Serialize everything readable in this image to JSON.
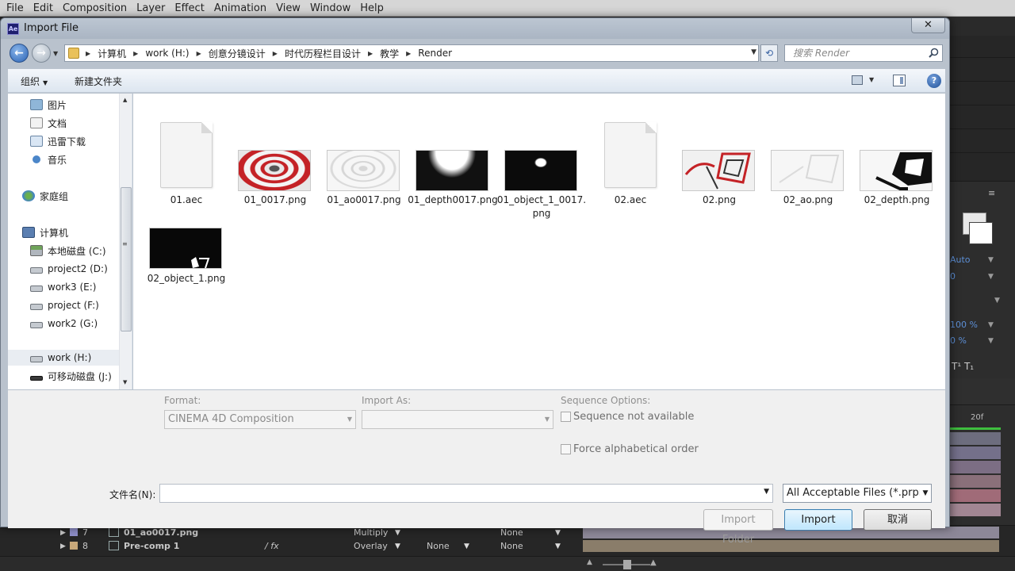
{
  "ae": {
    "menu": [
      "File",
      "Edit",
      "Composition",
      "Layer",
      "Effect",
      "Animation",
      "View",
      "Window",
      "Help"
    ],
    "right_panel": {
      "auto": "Auto",
      "zero": "0",
      "pct1": "100 %",
      "pct2": "0 %",
      "frame": "20f"
    },
    "timeline": [
      {
        "index": "7",
        "name": "01_ao0017.png",
        "mode": "Multiply",
        "trkmat": "",
        "parent": "None"
      },
      {
        "index": "8",
        "name": "Pre-comp 1",
        "mode": "Overlay",
        "trkmat": "None",
        "parent": "None"
      }
    ]
  },
  "dialog": {
    "title": "Import File",
    "close_label": "✕",
    "breadcrumbs": [
      "计算机",
      "work (H:)",
      "创意分镜设计",
      "时代历程栏目设计",
      "教学",
      "Render"
    ],
    "search_placeholder": "搜索 Render",
    "toolbar": {
      "organize": "组织",
      "new_folder": "新建文件夹"
    },
    "nav_items": [
      {
        "label": "图片",
        "icon": "pictures-icon"
      },
      {
        "label": "文档",
        "icon": "documents-icon"
      },
      {
        "label": "迅雷下载",
        "icon": "downloads-icon"
      },
      {
        "label": "音乐",
        "icon": "music-icon"
      },
      {
        "label": "家庭组",
        "icon": "homegroup-icon"
      },
      {
        "label": "计算机",
        "icon": "computer-icon"
      },
      {
        "label": "本地磁盘 (C:)",
        "icon": "drive-icon"
      },
      {
        "label": "project2 (D:)",
        "icon": "drive-icon"
      },
      {
        "label": "work3 (E:)",
        "icon": "drive-icon"
      },
      {
        "label": "project (F:)",
        "icon": "drive-icon"
      },
      {
        "label": "work2 (G:)",
        "icon": "drive-icon"
      },
      {
        "label": "work (H:)",
        "icon": "drive-icon"
      },
      {
        "label": "可移动磁盘 (J:)",
        "icon": "removable-drive-icon"
      }
    ],
    "selected_nav": "work (H:)",
    "files": [
      {
        "name": "01.aec",
        "kind": "doc"
      },
      {
        "name": "01_0017.png",
        "kind": "image"
      },
      {
        "name": "01_ao0017.png",
        "kind": "image"
      },
      {
        "name": "01_depth0017.png",
        "kind": "image"
      },
      {
        "name": "01_object_1_0017.png",
        "kind": "image"
      },
      {
        "name": "02.aec",
        "kind": "doc"
      },
      {
        "name": "02.png",
        "kind": "image"
      },
      {
        "name": "02_ao.png",
        "kind": "image"
      },
      {
        "name": "02_depth.png",
        "kind": "image"
      },
      {
        "name": "02_object_1.png",
        "kind": "image"
      }
    ],
    "options": {
      "format_label": "Format:",
      "format_value": "CINEMA 4D Composition",
      "import_as_label": "Import As:",
      "import_as_value": "",
      "sequence_label": "Sequence Options:",
      "sequence_checkbox": "Sequence not available",
      "force_alpha": "Force alphabetical order"
    },
    "filename_label": "文件名(N):",
    "filename_value": "",
    "file_type": "All Acceptable Files (*.prproj",
    "buttons": {
      "import_folder": "Import Folder",
      "import": "Import",
      "cancel": "取消"
    }
  }
}
